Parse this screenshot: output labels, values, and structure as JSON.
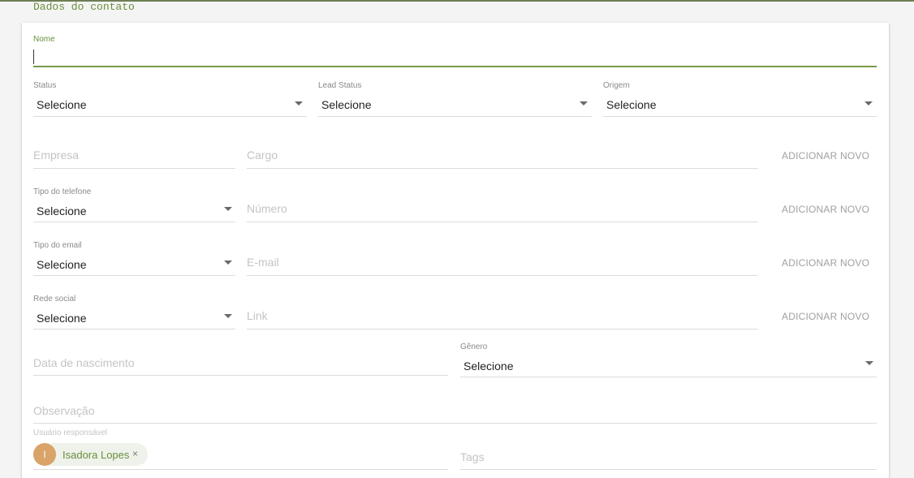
{
  "section": {
    "title": "Dados do contato"
  },
  "nome": {
    "label": "Nome",
    "value": ""
  },
  "status": {
    "label": "Status",
    "value": "Selecione"
  },
  "lead_status": {
    "label": "Lead Status",
    "value": "Selecione"
  },
  "origem": {
    "label": "Origem",
    "value": "Selecione"
  },
  "empresa": {
    "placeholder": "Empresa"
  },
  "cargo": {
    "placeholder": "Cargo"
  },
  "tipo_telefone": {
    "label": "Tipo do telefone",
    "value": "Selecione"
  },
  "numero": {
    "placeholder": "Número"
  },
  "tipo_email": {
    "label": "Tipo do email",
    "value": "Selecione"
  },
  "email": {
    "placeholder": "E-mail"
  },
  "rede_social": {
    "label": "Rede social",
    "value": "Selecione"
  },
  "link": {
    "placeholder": "Link"
  },
  "data_nascimento": {
    "placeholder": "Data de nascimento"
  },
  "genero": {
    "label": "Gênero",
    "value": "Selecione"
  },
  "observacao": {
    "placeholder": "Observação"
  },
  "usuario": {
    "label": "Usuário responsável",
    "chip_initial": "I",
    "chip_name": "Isadora Lopes",
    "chip_remove": "×"
  },
  "tags": {
    "placeholder": "Tags"
  },
  "buttons": {
    "add_new": "ADICIONAR NOVO"
  },
  "colors": {
    "accent": "#6b8f3e",
    "avatar": "#d9a36a"
  },
  "icons": {
    "dropdown": "dropdown-arrow-icon",
    "remove": "close-icon"
  }
}
